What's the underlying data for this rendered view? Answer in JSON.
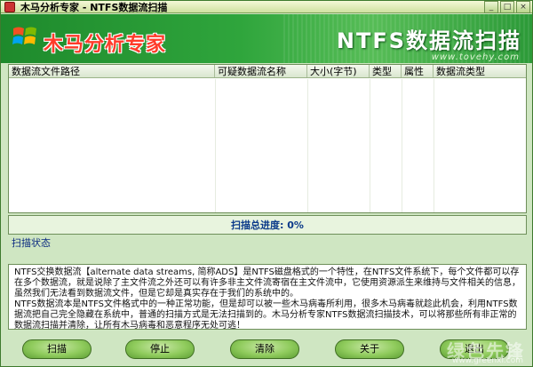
{
  "window": {
    "title": "木马分析专家 - NTFS数据流扫描",
    "min_label": "_",
    "max_label": "□",
    "close_label": "×"
  },
  "banner": {
    "logo_text": "木马分析专家",
    "title": "NTFS数据流扫描",
    "url": "www.tovehy.com"
  },
  "table": {
    "columns": [
      "数据流文件路径",
      "可疑数据流名称",
      "大小(字节)",
      "类型",
      "属性",
      "数据流类型"
    ],
    "rows": []
  },
  "progress": {
    "label": "扫描总进度: 0%",
    "value": 0
  },
  "status": {
    "label": "扫描状态",
    "text": ""
  },
  "description": {
    "paragraphs": [
      "NTFS交换数据流【alternate data streams, 简称ADS】是NTFS磁盘格式的一个特性，在NTFS文件系统下，每个文件都可以存在多个数据流，就是说除了主文件流之外还可以有许多非主文件流寄宿在主文件流中，它使用资源派生来维持与文件相关的信息，虽然我们无法看到数据流文件，但是它却是真实存在于我们的系统中的。",
      "NTFS数据流本是NTFS文件格式中的一种正常功能，但是却可以被一些木马病毒所利用，很多木马病毒就趁此机会，利用NTFS数据流把自己完全隐藏在系统中，普通的扫描方式是无法扫描到的。木马分析专家NTFS数据流扫描技术，可以将那些所有非正常的数据流扫描并清除，让所有木马病毒和恶意程序无处可逃！"
    ]
  },
  "buttons": {
    "scan": "扫描",
    "stop": "停止",
    "clear": "清除",
    "about": "关于",
    "exit": "退出"
  },
  "watermark": {
    "text": "绿色先锋",
    "url": "www.greenxf.com"
  },
  "colors": {
    "banner_green": "#2fa53c",
    "window_bg": "#cfe6c2",
    "button_green": "#8fcb5c",
    "progress_text": "#0b3a8a"
  }
}
